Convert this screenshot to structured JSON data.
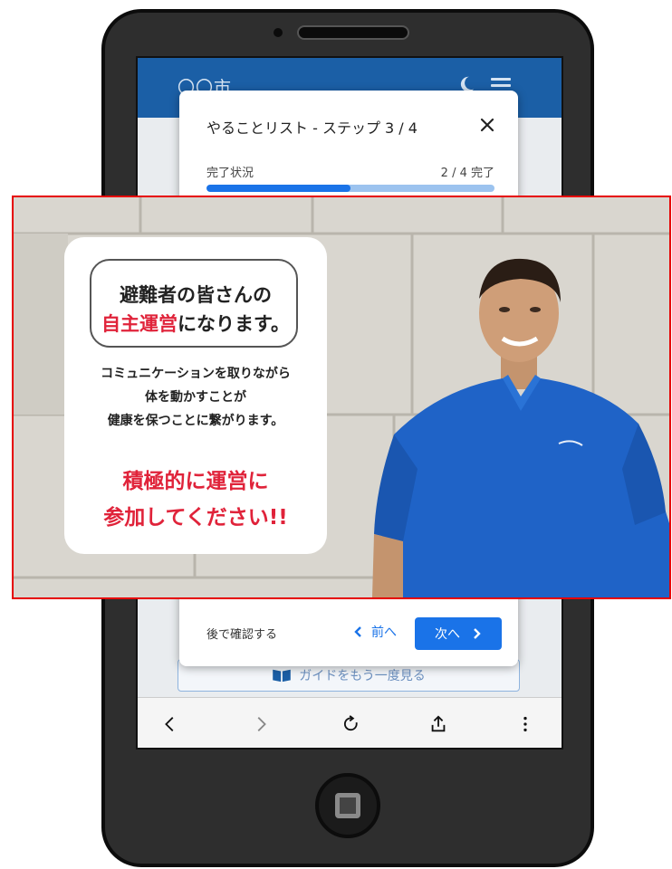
{
  "app": {
    "title": "〇〇市",
    "guide_button_label": "ガイドをもう一度見る"
  },
  "modal": {
    "title": "やることリスト - ステップ 3 / 4",
    "progress_label": "完了状況",
    "progress_count": "2 / 4 完了",
    "progress_fraction": 0.5,
    "later_label": "後で確認する",
    "prev_label": "前へ",
    "next_label": "次へ"
  },
  "video_card": {
    "boxed_line1": "避難者の皆さんの",
    "boxed_line2_highlight": "自主運営",
    "boxed_line2_rest": "になります。",
    "body_line1": "コミュニケーションを取りながら",
    "body_line2": "体を動かすことが",
    "body_line3": "健康を保つことに繋がります。",
    "call_line1": "積極的に運営に",
    "call_line2": "参加してください!!"
  },
  "colors": {
    "header": "#1b5fa6",
    "accent": "#1a73e8",
    "highlight_red": "#e0233a",
    "overlay_border": "#e60000",
    "shirt": "#1f63c7"
  },
  "icons": [
    "moon-icon",
    "menu-icon",
    "close-icon",
    "chevron-left-icon",
    "chevron-right-icon",
    "book-icon",
    "back-icon",
    "forward-icon",
    "reload-icon",
    "share-icon",
    "more-vert-icon"
  ]
}
